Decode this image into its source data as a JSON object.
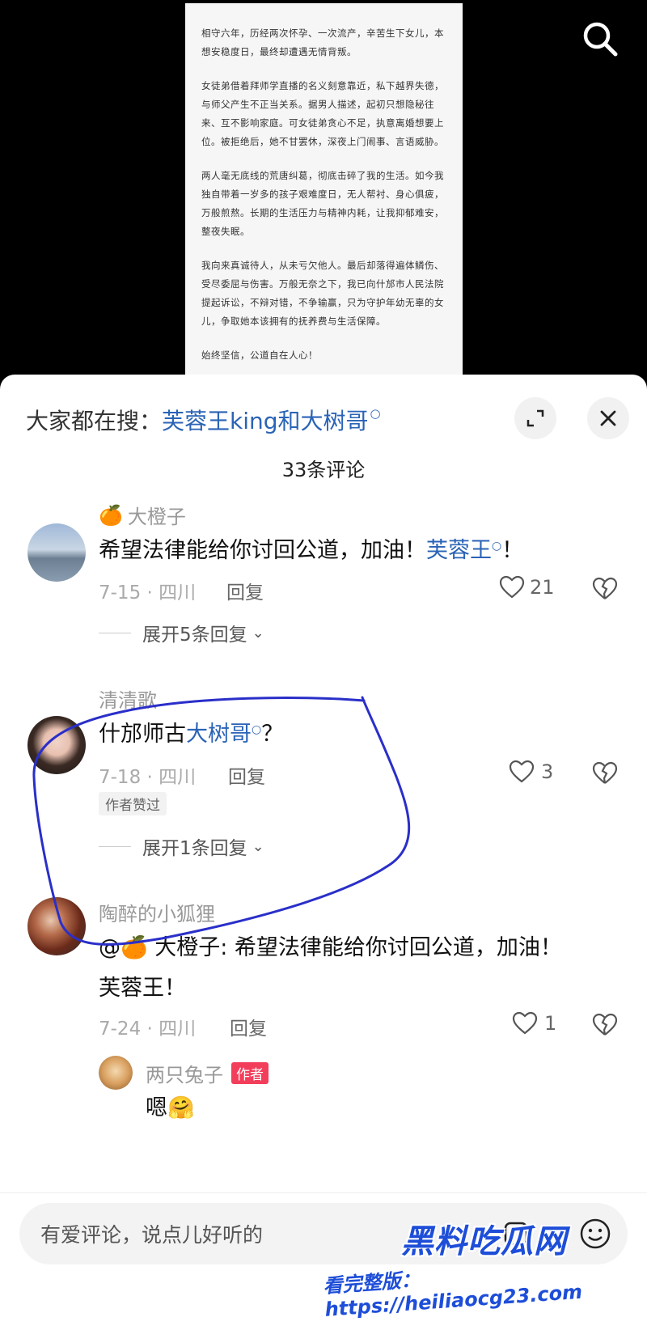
{
  "document": {
    "paragraphs": [
      "相守六年，历经两次怀孕、一次流产，辛苦生下女儿，本想安稳度日，最终却遭遇无情背叛。",
      "女徒弟借着拜师学直播的名义刻意靠近，私下越界失德，与师父产生不正当关系。据男人描述，起初只想隐秘往来、互不影响家庭。可女徒弟贪心不足，执意离婚想要上位。被拒绝后，她不甘罢休，深夜上门闹事、言语威胁。",
      "两人毫无底线的荒唐纠葛，彻底击碎了我的生活。如今我独自带着一岁多的孩子艰难度日，无人帮衬、身心俱疲，万般煎熬。长期的生活压力与精神内耗，让我抑郁难安，整夜失眠。",
      "我向来真诚待人，从未亏欠他人。最后却落得遍体鳞伤、受尽委屈与伤害。万般无奈之下，我已向什邡市人民法院提起诉讼，不辩对错，不争输赢，只为守护年幼无辜的女儿，争取她本该拥有的抚养费与生活保障。",
      "始终坚信，公道自在人心！"
    ]
  },
  "sheet": {
    "search_prefix": "大家都在搜：",
    "search_keyword": "芙蓉王king和大树哥",
    "comment_count": "33条评论"
  },
  "comments": [
    {
      "user": "大橙子",
      "user_emoji": "🍊",
      "text_before": "希望法律能给你讨回公道，加油！",
      "text_link": "芙蓉王",
      "text_after": "！",
      "date": "7-15 · 四川",
      "reply_label": "回复",
      "likes": "21",
      "expand": "展开5条回复"
    },
    {
      "user": "清清歌",
      "text_before": "什邡师古",
      "text_link": "大树哥",
      "text_after": "？",
      "date": "7-18 · 四川",
      "reply_label": "回复",
      "likes": "3",
      "badge": "作者赞过",
      "expand": "展开1条回复"
    },
    {
      "user": "陶醉的小狐狸",
      "text_line1": "@🍊 大橙子: 希望法律能给你讨回公道，加油！",
      "text_line2": "芙蓉王！",
      "date": "7-24 · 四川",
      "reply_label": "回复",
      "likes": "1"
    }
  ],
  "sub_reply": {
    "user": "两只兔子",
    "author_tag": "作者",
    "text": "嗯",
    "emoji": "🤗"
  },
  "input": {
    "placeholder": "有爱评论，说点儿好听的"
  },
  "watermark": {
    "line1": "黑料吃瓜网",
    "line2": "看完整版：https://heiliaocg23.com"
  },
  "colors": {
    "link": "#2a63b6",
    "author_tag": "#f33e5b",
    "annotation": "#2a2fc9"
  }
}
